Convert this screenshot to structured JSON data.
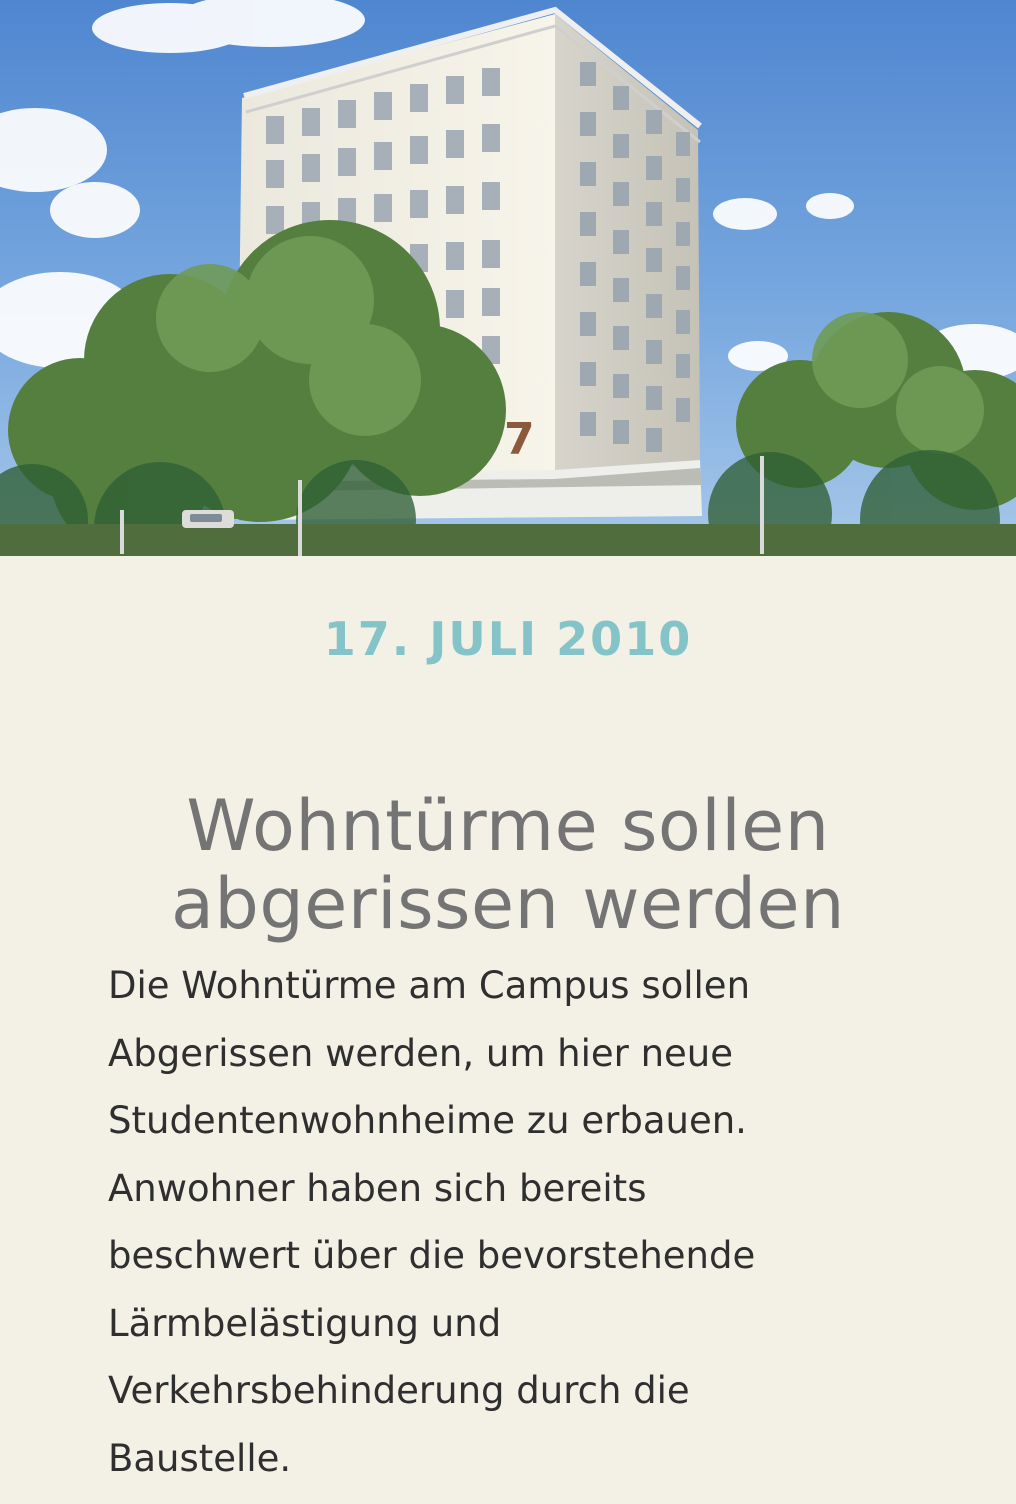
{
  "article": {
    "date": "17. JULI 2010",
    "title_lines": [
      "Wohntürme sollen",
      "abgerissen werden"
    ],
    "body_lines": [
      "Die Wohntürme am Campus sollen",
      "Abgerissen werden, um hier neue",
      "Studentenwohnheime zu erbauen.",
      "Anwohner haben sich bereits",
      "beschwert über die bevorstehende",
      "Lärmbelästigung und",
      "Verkehrsbehinderung durch die",
      "Baustelle."
    ],
    "building_number": "7"
  },
  "colors": {
    "date": "#84c3c8",
    "title": "#747474",
    "body": "#2f2f2f",
    "background": "#f3f0e6"
  }
}
